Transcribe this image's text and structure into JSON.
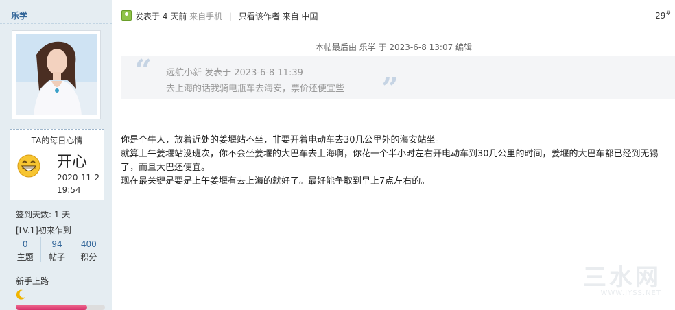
{
  "author": {
    "name": "乐学",
    "mood_title": "TA的每日心情",
    "mood_value": "开心",
    "mood_date": "2020-11-2",
    "mood_time": "19:54",
    "checkin": "签到天数: 1 天",
    "level": "[LV.1]初来乍到",
    "stats": [
      {
        "num": "0",
        "label": "主题"
      },
      {
        "num": "94",
        "label": "帖子"
      },
      {
        "num": "400",
        "label": "积分"
      }
    ],
    "medal_label": "新手上路",
    "progress_fraction": 0.8
  },
  "post": {
    "posted": "发表于 4 天前",
    "source": "来自手机",
    "only_author": "只看该作者",
    "location": "来自 中国",
    "floor": "29",
    "floor_sup": "#",
    "edited_note": "本帖最后由 乐学 于 2023-6-8 13:07 编辑",
    "quote": {
      "header": "远航小新 发表于 2023-6-8 11:39",
      "body": "去上海的话我骑电瓶车去海安，票价还便宜些"
    },
    "paragraphs": [
      "你是个牛人，放着近处的姜堰站不坐，非要开着电动车去30几公里外的海安站坐。",
      "就算上午姜堰站没班次，你不会坐姜堰的大巴车去上海啊，你花一个半小时左右开电动车到30几公里的时间，姜堰的大巴车都已经到无锡了，而且大巴还便宜。",
      "现在最关键是要是上午姜堰有去上海的就好了。最好能争取到早上7点左右的。"
    ]
  },
  "watermark": {
    "line1": "三水网",
    "line2": "WWW.JYSS.NET"
  }
}
